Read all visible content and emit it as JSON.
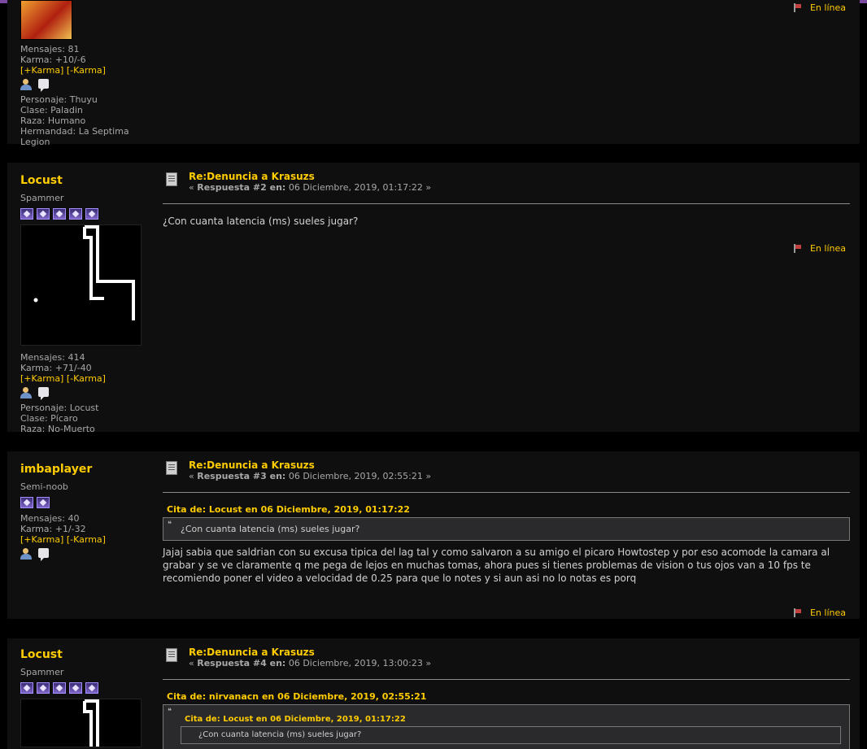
{
  "posts": [
    {
      "poster": {
        "stats": {
          "messages": "Mensajes: 81",
          "karma": "Karma: +10/-6"
        },
        "karma_links": "[+Karma] [-Karma]",
        "character": "Personaje: Thuyu",
        "class": "Clase: Paladin",
        "race": "Raza: Humano",
        "guild": "Hermandad: La Septima Legion"
      },
      "online": "En línea"
    },
    {
      "poster": {
        "name": "Locust",
        "rank": "Spammer",
        "stats": {
          "messages": "Mensajes: 414",
          "karma": "Karma: +71/-40"
        },
        "karma_links": "[+Karma] [-Karma]",
        "character": "Personaje: Locust",
        "class": "Clase: Pícaro",
        "race": "Raza: No-Muerto"
      },
      "subject": "Re:Denuncia a Krasuzs",
      "meta_prefix": "« ",
      "meta_label": "Respuesta #2 en:",
      "meta_date": " 06 Diciembre, 2019, 01:17:22 »",
      "message": "¿Con cuanta latencia (ms) sueles jugar?",
      "online": "En línea"
    },
    {
      "poster": {
        "name": "imbaplayer",
        "rank": "Semi-noob",
        "stats": {
          "messages": "Mensajes: 40",
          "karma": "Karma: +1/-32"
        },
        "karma_links": "[+Karma] [-Karma]"
      },
      "subject": "Re:Denuncia a Krasuzs",
      "meta_prefix": "« ",
      "meta_label": "Respuesta #3 en:",
      "meta_date": " 06 Diciembre, 2019, 02:55:21 »",
      "cite": "Cita de: Locust en 06 Diciembre, 2019, 01:17:22",
      "quote": "¿Con cuanta latencia (ms) sueles jugar?",
      "message": "Jajaj sabia que saldrian con su excusa tipica del lag tal y como salvaron a su amigo el picaro Howtostep y por eso acomode la camara al grabar y se ve claramente q me pega de lejos en muchas tomas, ahora pues si tienes problemas de vision o tus ojos van a 10 fps te recomiendo poner el video a velocidad de 0.25 para que lo notes y si aun asi no lo notas es porq",
      "online": "En línea"
    },
    {
      "poster": {
        "name": "Locust",
        "rank": "Spammer"
      },
      "subject": "Re:Denuncia a Krasuzs",
      "meta_prefix": "« ",
      "meta_label": "Respuesta #4 en:",
      "meta_date": " 06 Diciembre, 2019, 13:00:23 »",
      "cite": "Cita de: nirvanacn en 06 Diciembre, 2019, 02:55:21",
      "nested_cite": "Cita de: Locust en 06 Diciembre, 2019, 01:17:22",
      "nested_quote": "¿Con cuanta latencia (ms) sueles jugar?"
    }
  ],
  "colors": {
    "accent": "#ffcc00",
    "topbar": "#7a4aa0",
    "post_bg": "#0f0f10"
  }
}
